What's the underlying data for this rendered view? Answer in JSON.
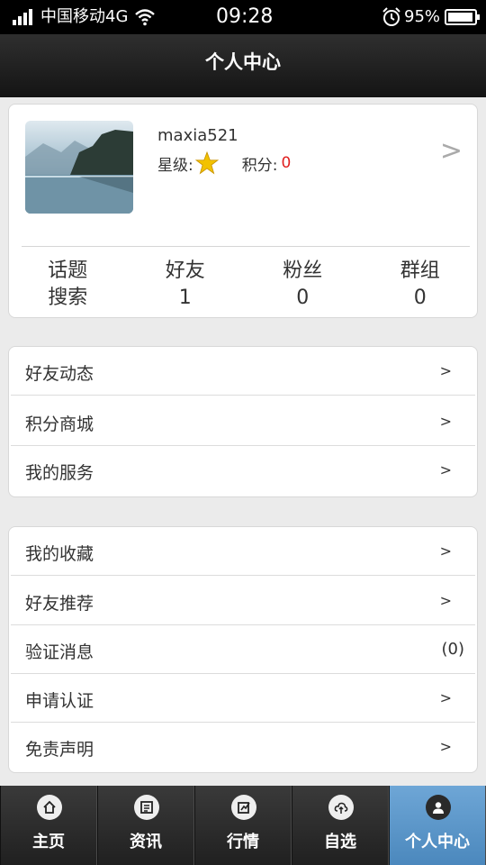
{
  "status_bar": {
    "carrier": "中国移动4G",
    "time": "09:28",
    "battery": "95%"
  },
  "header": {
    "title": "个人中心"
  },
  "profile": {
    "username": "maxia521",
    "level_label": "星级:",
    "points_label": "积分:",
    "points_value": "0",
    "arrow": ">"
  },
  "stats": [
    {
      "label": "话题",
      "sub": "搜索"
    },
    {
      "label": "好友",
      "sub": "1"
    },
    {
      "label": "粉丝",
      "sub": "0"
    },
    {
      "label": "群组",
      "sub": "0"
    }
  ],
  "menu1": [
    {
      "label": "好友动态",
      "arrow": ">"
    },
    {
      "label": "积分商城",
      "arrow": ">"
    },
    {
      "label": "我的服务",
      "arrow": ">"
    }
  ],
  "menu2": [
    {
      "label": "我的收藏",
      "arrow": ">"
    },
    {
      "label": "好友推荐",
      "arrow": ">"
    },
    {
      "label": "验证消息",
      "count": "(0)"
    },
    {
      "label": "申请认证",
      "arrow": ">"
    },
    {
      "label": "免责声明",
      "arrow": ">"
    }
  ],
  "tabs": [
    {
      "label": "主页",
      "icon": "home-icon"
    },
    {
      "label": "资讯",
      "icon": "news-icon"
    },
    {
      "label": "行情",
      "icon": "market-icon"
    },
    {
      "label": "自选",
      "icon": "cloud-icon"
    },
    {
      "label": "个人中心",
      "icon": "user-icon",
      "active": true
    }
  ],
  "colors": {
    "accent_tab": "#5b97c9",
    "points_red": "#e02020",
    "background": "#ebebeb"
  }
}
